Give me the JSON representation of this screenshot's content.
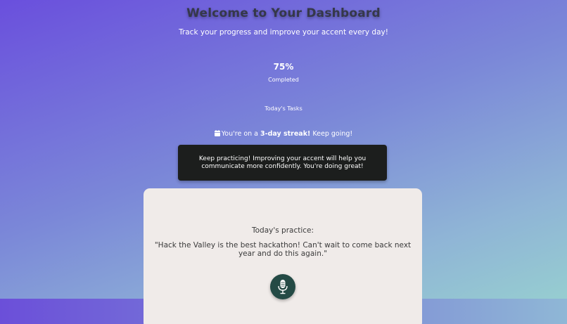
{
  "header": {
    "title": "Welcome to Your Dashboard",
    "subtitle": "Track your progress and improve your accent every day!"
  },
  "progress": {
    "percent_label": "75%",
    "value": 0.75,
    "caption": "Completed"
  },
  "tasks": {
    "label": "Today's Tasks"
  },
  "streak": {
    "icon": "calendar-icon",
    "prefix": "You're on a ",
    "highlight": "3-day streak!",
    "suffix": " Keep going!"
  },
  "encouragement": {
    "text": "Keep practicing! Improving your accent will help you communicate more confidently. You're doing great!"
  },
  "practice": {
    "label": "Today's practice:",
    "quote": "\"Hack the Valley is the best hackathon! Can't wait to come back next year and do this again.\"",
    "mic_icon": "microphone-icon"
  },
  "colors": {
    "title": "#35384a",
    "tip_box": "#1c1e1d",
    "card": "#f0ebe9",
    "mic_button": "#244a45"
  }
}
